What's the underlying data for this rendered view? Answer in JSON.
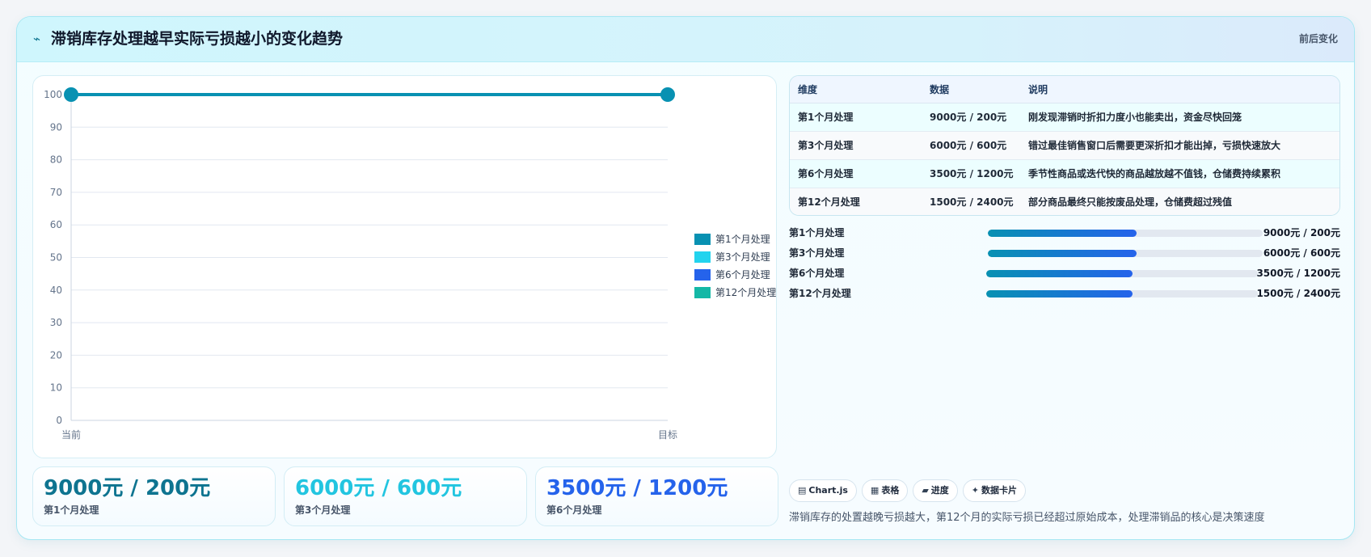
{
  "header": {
    "icon": "trend-line-icon",
    "title": "滞销库存处理越早实际亏损越小的变化趋势",
    "tag": "前后变化"
  },
  "chart_data": {
    "type": "line",
    "x": [
      "当前",
      "目标"
    ],
    "ylim": [
      0,
      100
    ],
    "yticks": [
      0,
      10,
      20,
      30,
      40,
      50,
      60,
      70,
      80,
      90,
      100
    ],
    "series": [
      {
        "values": [
          100,
          100
        ]
      }
    ],
    "grid": true,
    "line_color": "#0891b2",
    "legend_placement": "right",
    "legend": [
      {
        "name": "第1个月处理",
        "color": "#0891b2"
      },
      {
        "name": "第3个月处理",
        "color": "#22d3ee"
      },
      {
        "name": "第6个月处理",
        "color": "#2563eb"
      },
      {
        "name": "第12个月处理",
        "color": "#14b8a6"
      }
    ]
  },
  "table": {
    "headers": [
      "维度",
      "数据",
      "说明"
    ],
    "rows": [
      {
        "dim": "第1个月处理",
        "data": "9000元 / 200元",
        "note": "刚发现滞销时折扣力度小也能卖出，资金尽快回笼"
      },
      {
        "dim": "第3个月处理",
        "data": "6000元 / 600元",
        "note": "错过最佳销售窗口后需要更深折扣才能出掉，亏损快速放大"
      },
      {
        "dim": "第6个月处理",
        "data": "3500元 / 1200元",
        "note": "季节性商品或迭代快的商品越放越不值钱，仓储费持续累积"
      },
      {
        "dim": "第12个月处理",
        "data": "1500元 / 2400元",
        "note": "部分商品最终只能按废品处理，仓储费超过残值"
      }
    ]
  },
  "progress": [
    {
      "label": "第1个月处理",
      "value": "9000元 / 200元",
      "level": 0.54
    },
    {
      "label": "第3个月处理",
      "value": "6000元 / 600元",
      "level": 0.54
    },
    {
      "label": "第6个月处理",
      "value": "3500元 / 1200元",
      "level": 0.54
    },
    {
      "label": "第12个月处理",
      "value": "1500元 / 2400元",
      "level": 0.54
    }
  ],
  "kpis": [
    {
      "value": "9000元 / 200元",
      "label": "第1个月处理",
      "color": "#0e7490"
    },
    {
      "value": "6000元 / 600元",
      "label": "第3个月处理",
      "color": "#22c5e0"
    },
    {
      "value": "3500元 / 1200元",
      "label": "第6个月处理",
      "color": "#2563eb"
    }
  ],
  "chips": [
    {
      "icon": "chart-icon",
      "glyph": "▤",
      "label": "Chart.js"
    },
    {
      "icon": "table-icon",
      "glyph": "▦",
      "label": "表格"
    },
    {
      "icon": "progress-icon",
      "glyph": "▰",
      "label": "进度"
    },
    {
      "icon": "sparkle-icon",
      "glyph": "✦",
      "label": "数据卡片"
    }
  ],
  "summary": "滞销库存的处置越晚亏损越大，第12个月的实际亏损已经超过原始成本，处理滞销品的核心是决策速度"
}
